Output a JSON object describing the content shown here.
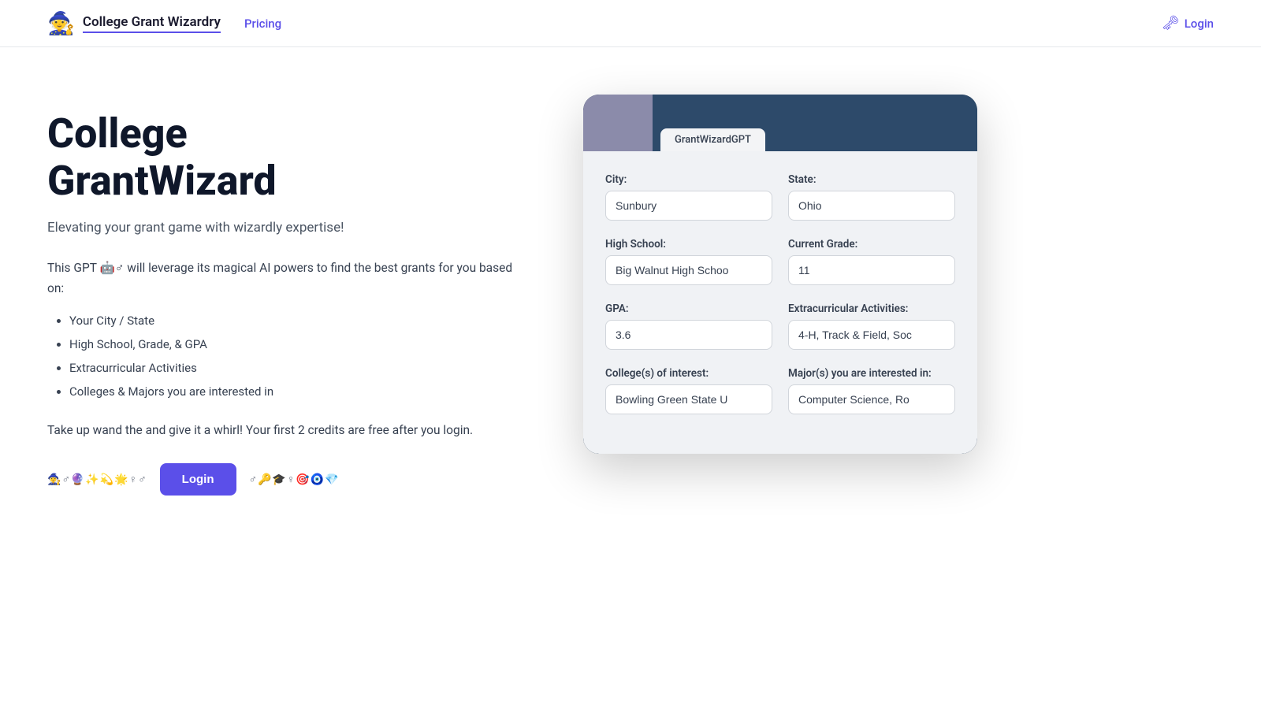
{
  "navbar": {
    "logo": "🧙",
    "title": "College Grant Wizardry",
    "nav_links": [
      {
        "label": "Pricing",
        "href": "#"
      }
    ],
    "login_label": "Login",
    "key_icon": "🗝"
  },
  "hero": {
    "title": "College\nGrantWizard",
    "subtitle": "Elevating your grant game with wizardly expertise!",
    "description": "This GPT 🤖♂ will leverage its magical AI powers to find the best grants for you based on:",
    "features": [
      "Your City / State",
      "High School, Grade, & GPA",
      "Extracurricular Activities",
      "Colleges & Majors you are interested in"
    ],
    "cta_text": "Take up wand the and give it a whirl! Your first 2 credits are free after you login.",
    "emoji_left": "🧙‍♀️♂🔮✨💫🌟♀♂",
    "login_btn": "Login",
    "emoji_right": "♂🔑🎓♀🎯🧿💎"
  },
  "gpt_ui": {
    "tab_label": "GrantWizardGPT",
    "form": {
      "city_label": "City:",
      "city_value": "Sunbury",
      "state_label": "State:",
      "state_value": "Ohio",
      "high_school_label": "High School:",
      "high_school_value": "Big Walnut High Schoo",
      "current_grade_label": "Current Grade:",
      "current_grade_value": "11",
      "gpa_label": "GPA:",
      "gpa_value": "3.6",
      "extracurricular_label": "Extracurricular Activities:",
      "extracurricular_value": "4-H, Track & Field, Soc",
      "colleges_label": "College(s) of interest:",
      "colleges_value": "Bowling Green State U",
      "majors_label": "Major(s) you are interested in:",
      "majors_value": "Computer Science, Ro"
    }
  }
}
